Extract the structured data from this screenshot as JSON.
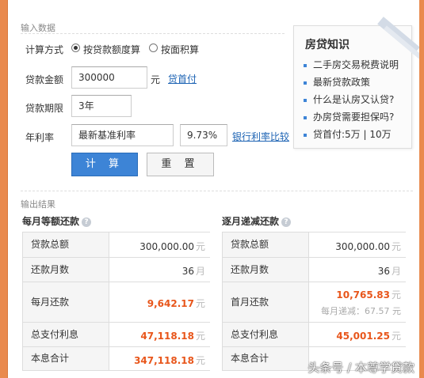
{
  "input_section": {
    "title": "输入数据",
    "calc_method_label": "计算方式",
    "radio_by_amount": "按贷款额度算",
    "radio_by_area": "按面积算",
    "loan_amount_label": "贷款金额",
    "loan_amount_value": "300000",
    "loan_amount_unit": "元",
    "down_payment_link": "贷首付",
    "term_label": "贷款期限",
    "term_value": "3年",
    "rate_label": "年利率",
    "rate_select": "最新基准利率",
    "rate_value": "9.73%",
    "rate_compare_link": "银行利率比较",
    "calc_button": "计 算",
    "reset_button": "重 置"
  },
  "knowledge": {
    "title": "房贷知识",
    "items": [
      "二手房交易税费说明",
      "最新贷款政策",
      "什么是认房又认贷?",
      "办房贷需要担保吗?",
      "贷首付:5万 | 10万"
    ]
  },
  "output_section": {
    "title": "输出结果",
    "left": {
      "title": "每月等额还款",
      "rows": [
        {
          "key": "贷款总额",
          "value": "300,000.00",
          "unit": "元"
        },
        {
          "key": "还款月数",
          "value": "36",
          "unit": "月"
        },
        {
          "key": "每月还款",
          "value": "9,642.17",
          "unit": "元"
        },
        {
          "key": "总支付利息",
          "value": "47,118.18",
          "unit": "元"
        },
        {
          "key": "本息合计",
          "value": "347,118.18",
          "unit": "元"
        }
      ]
    },
    "right": {
      "title": "逐月递减还款",
      "rows": [
        {
          "key": "贷款总额",
          "value": "300,000.00",
          "unit": "元"
        },
        {
          "key": "还款月数",
          "value": "36",
          "unit": "月"
        },
        {
          "key": "首月还款",
          "value": "10,765.83",
          "unit": "元",
          "sub": "每月递减：67.57 元"
        },
        {
          "key": "总支付利息",
          "value": "45,001.25",
          "unit": "元"
        },
        {
          "key": "本息合计",
          "value": "",
          "unit": ""
        }
      ]
    }
  },
  "watermark": "头条号 / 本尊学贷款"
}
